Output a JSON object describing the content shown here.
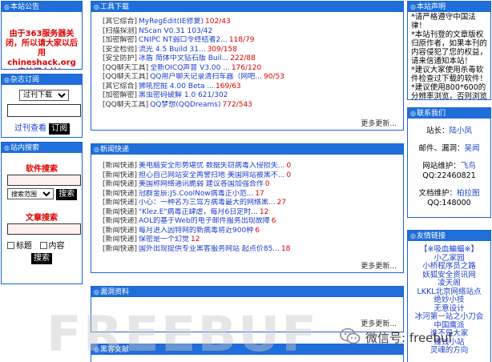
{
  "announce": {
    "heading": "本站公告",
    "message": "由于363服务器关闭，所以请大家以后用chineshack.org来访问本站！"
  },
  "subscribe": {
    "heading": "杂志订阅",
    "select_value": "过刊下载",
    "view_link": "过刊查看",
    "subscribe_button": "订阅"
  },
  "search": {
    "heading": "站内搜索",
    "software_title": "软件搜索",
    "scope_value": "搜索范围",
    "search_button": "搜索",
    "article_title": "文章搜索",
    "option_title": "标题",
    "option_content": "内容",
    "search_button2": "搜索"
  },
  "tools": {
    "heading": "工具下载",
    "items": [
      {
        "cat": "[其它综合]",
        "title": "MyRegEdit(IE修复)",
        "count": "102/43"
      },
      {
        "cat": "[扫描探测]",
        "title": "NScan V0.31 103/42",
        "count": ""
      },
      {
        "cat": "[加密解密]",
        "title": "CNIPC NT弱口令终结者2...",
        "count": "118/79"
      },
      {
        "cat": "[安全检验]",
        "title": "流光 4.5 Build 31...",
        "count": "309/158"
      },
      {
        "cat": "[安全防护]",
        "title": "冰盾 简体中文钻石版 Buil...",
        "count": "222/88"
      },
      {
        "cat": "[QQ聊天工具]",
        "title": "全新OICQ声音 V3.00 ...",
        "count": "176/120"
      },
      {
        "cat": "[QQ聊天工具]",
        "title": "QQ用户聊天记录清扫车器（网吧...",
        "count": "90/53"
      },
      {
        "cat": "[其它综合]",
        "title": "狮吼挖掘 4.00 Beta ...",
        "count": "169/63"
      },
      {
        "cat": "[加密解密]",
        "title": "黑虫密码破解 1.0 621/302",
        "count": ""
      },
      {
        "cat": "[QQ聊天工具]",
        "title": "QQ梦想(QQDreams)",
        "count": "772/543"
      }
    ],
    "more": "更多更新..."
  },
  "news": {
    "heading": "新闻快递",
    "items": [
      {
        "cat": "[新闻快递]",
        "title": "美电脑安全形势堪忧 数据失窃病毒入侵损失...",
        "count": "0"
      },
      {
        "cat": "[新闻快递]",
        "title": "担心自己网站安全再警扫地 美国网站被黑不...",
        "count": "0"
      },
      {
        "cat": "[新闻快递]",
        "title": "美国称网络通讯脆弱 建议各国加强合作",
        "count": "0"
      },
      {
        "cat": "[新闻快递]",
        "title": "冠群金辰:JS.CoolNow病毒正小范...",
        "count": "17"
      },
      {
        "cat": "[新闻快递]",
        "title": "小心：一种名为三驾方病毒最大的网络黑...",
        "count": "27"
      },
      {
        "cat": "[新闻快递]",
        "title": "\"Klez.E\"病毒正肆虐，每月6日定时...",
        "count": "12"
      },
      {
        "cat": "[新闻快递]",
        "title": "AOL的基于Web的电子邮件服务出现故障",
        "count": "6"
      },
      {
        "cat": "[新闻快递]",
        "title": "每月进入因特网的新病毒将近900种",
        "count": "6"
      },
      {
        "cat": "[新闻快递]",
        "title": "保密是一个幻觉",
        "count": "12"
      },
      {
        "cat": "[新闻快递]",
        "title": "国外出现提供专业黑客服务网站 起点价85...",
        "count": "18"
      }
    ],
    "more": "更多更新..."
  },
  "vuln": {
    "heading": "漏洞资料",
    "more": "更多更新..."
  },
  "hacker": {
    "heading": "黑客文献"
  },
  "notice": {
    "heading": "本站声明",
    "lines": [
      "*请严格遵守中国法律！",
      "*本站刊登的文章版权归原作者，如果本刊的内容侵犯了您的权益，请来信通知本站！",
      "*建议大家使用杀毒软件检查过下载的软件！",
      "*建议使用800*600的分辨率浏览，否则浏览效果会大打折扣"
    ]
  },
  "contact": {
    "heading": "联系我们",
    "owner_label": "站长：",
    "owner_name": "陆小凤",
    "mail_label": "邮件、漏洞：",
    "mail_name": "吴闻",
    "maint_label": "网站维护：",
    "maint_name": "飞鸟",
    "maint_qq": "QQ:22460821",
    "edit_label": "文档维护：",
    "edit_name": "柏拉图",
    "edit_qq": "QQ:148000"
  },
  "links": {
    "heading": "友情链接",
    "items": [
      "【※吸血蝙蝠※】",
      "小乙家园",
      "小桥程序员之路",
      "妖狐安全资讯网",
      "凌天阁",
      "LKKL北京网络站点",
      "绝妙小技",
      "无意设计",
      "冰河第一站之小刀会",
      "中国鹰派",
      "谁不是大家",
      "赚钱小站",
      "灵魂的方向"
    ]
  },
  "watermark": {
    "logo_text": "FREEBUF",
    "wechat_text": "微信号: freebuf"
  }
}
